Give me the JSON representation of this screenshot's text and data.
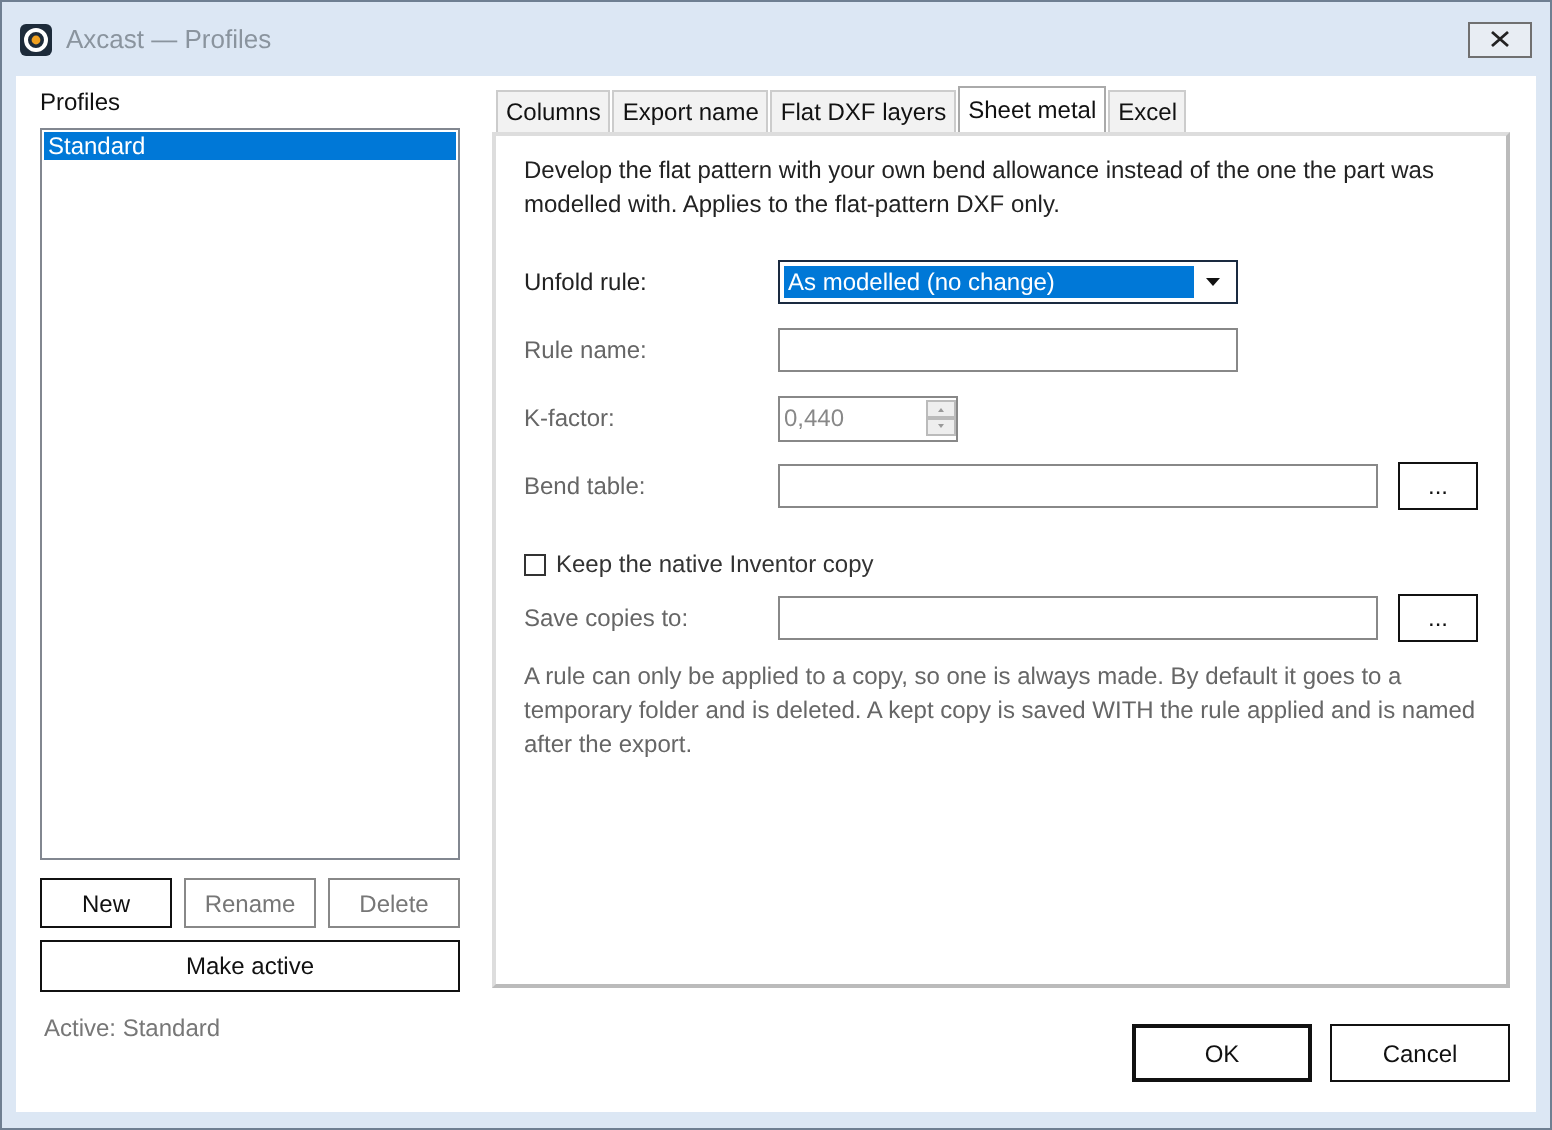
{
  "window": {
    "title": "Axcast — Profiles"
  },
  "profiles": {
    "label": "Profiles",
    "items": [
      {
        "name": "Standard",
        "selected": true
      }
    ],
    "buttons": [
      {
        "label": "New",
        "disabled": false
      },
      {
        "label": "Rename",
        "disabled": true
      },
      {
        "label": "Delete",
        "disabled": true
      }
    ],
    "make_active": "Make active",
    "active_text": "Active: Standard"
  },
  "tabs": [
    {
      "label": "Columns",
      "selected": false
    },
    {
      "label": "Export name",
      "selected": false
    },
    {
      "label": "Flat DXF layers",
      "selected": false
    },
    {
      "label": "Sheet metal",
      "selected": true
    },
    {
      "label": "Excel",
      "selected": false
    }
  ],
  "sheet_metal": {
    "intro": "Develop the flat pattern with your own bend allowance instead of the one the part was modelled with. Applies to the flat-pattern DXF only.",
    "fields": [
      {
        "kind": "dropdown",
        "label": "Unfold rule:",
        "value": "As modelled (no change)",
        "disabled": false
      },
      {
        "kind": "text",
        "label": "Rule name:",
        "disabled": true
      },
      {
        "kind": "spinner",
        "label": "K-factor:",
        "value": "0,440",
        "disabled": true
      },
      {
        "kind": "browse",
        "label": "Bend table:",
        "button": "...",
        "disabled": true
      }
    ],
    "keep_copy": {
      "label": "Keep the native Inventor copy",
      "checked": false
    },
    "save_to": {
      "label": "Save copies to:",
      "button": "...",
      "disabled": true
    },
    "note": "A rule can only be applied to a copy, so one is always made. By default it goes to a temporary folder and is deleted. A kept copy is saved WITH the rule applied and is named after the export."
  },
  "dialog_buttons": [
    {
      "label": "OK",
      "default": true
    },
    {
      "label": "Cancel",
      "default": false
    }
  ]
}
